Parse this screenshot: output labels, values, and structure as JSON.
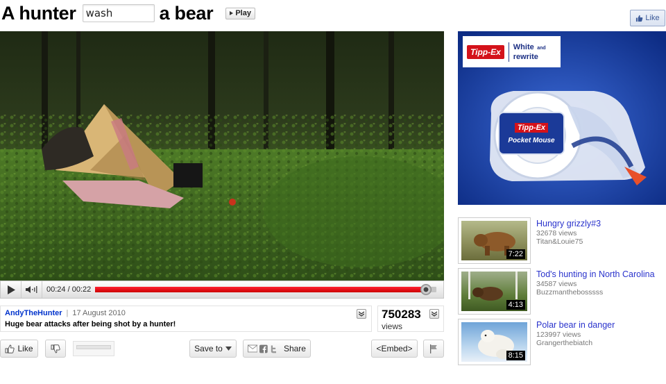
{
  "header": {
    "title_before": "A hunter",
    "input_value": "wash",
    "title_after": "a bear",
    "play_label": "Play",
    "fb_like_label": "Like"
  },
  "player": {
    "time": "00:24 / 00:22",
    "progress": 0.97
  },
  "info": {
    "uploader": "AndyTheHunter",
    "separator": "|",
    "date": "17 August 2010",
    "description": "Huge bear attacks after being shot by a hunter!",
    "views_count": "750283",
    "views_label": "views"
  },
  "actions": {
    "like_label": "Like",
    "save_label": "Save to",
    "share_label": "Share",
    "embed_label": "<Embed>"
  },
  "ad": {
    "brand": "Tipp-Ex",
    "tagline_line1": "White",
    "tagline_and": "and",
    "tagline_line2": "rewrite",
    "product": "Pocket Mouse"
  },
  "related": [
    {
      "title": "Hungry grizzly#3",
      "views": "32678 views",
      "author": "Titan&Louie75",
      "duration": "7:22"
    },
    {
      "title": "Tod's hunting in North Carolina",
      "views": "34587 views",
      "author": "Buzzmanthebosssss",
      "duration": "4:13"
    },
    {
      "title": "Polar bear in danger",
      "views": "123997 views",
      "author": "Grangerthebiatch",
      "duration": "8:15"
    }
  ],
  "colors": {
    "link_blue": "#0033cc",
    "progress_red": "#e01010",
    "ad_blue": "#1a3fa8",
    "tippex_red": "#d4121a"
  }
}
